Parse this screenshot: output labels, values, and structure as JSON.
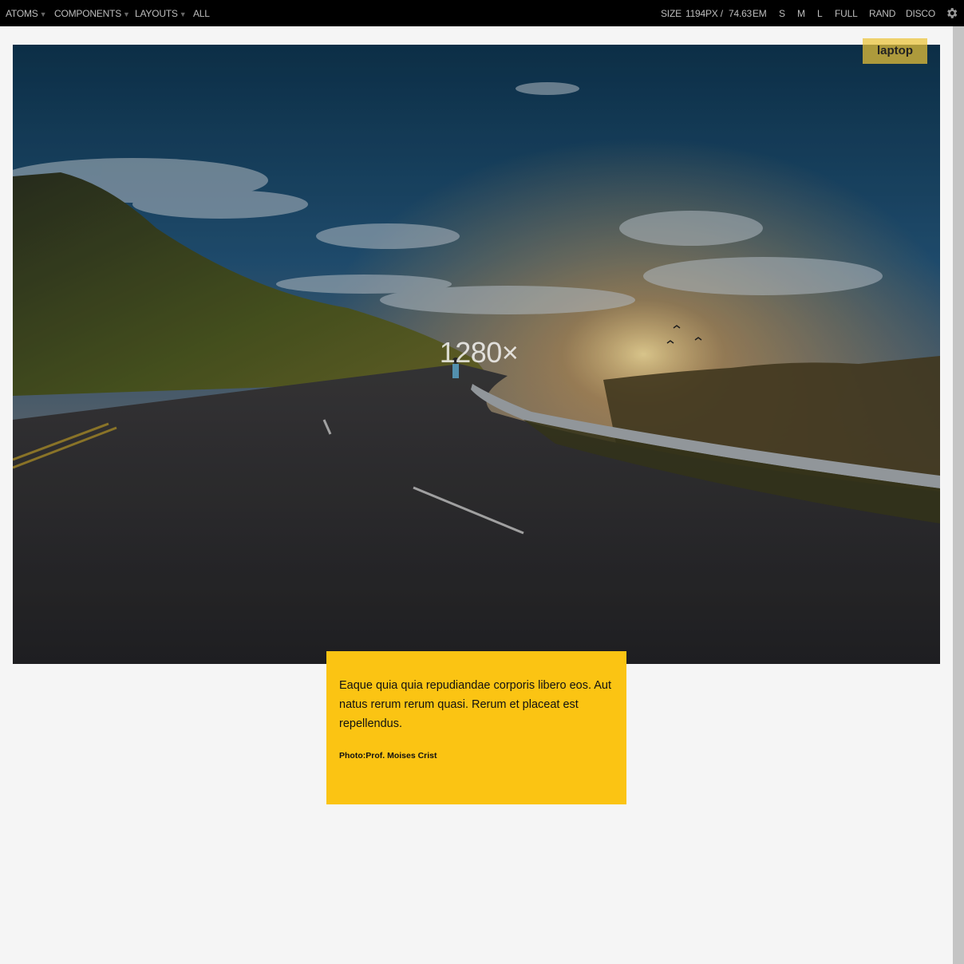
{
  "toolbar": {
    "atoms": "ATOMS",
    "components": "COMPONENTS",
    "layouts": "LAYOUTS",
    "all": "ALL",
    "size_label": "SIZE",
    "size_px": "1194",
    "px_unit": "PX /",
    "size_em": "74.63",
    "em_unit": "EM",
    "s": "S",
    "m": "M",
    "l": "L",
    "full": "FULL",
    "rand": "RAND",
    "disco": "DISCO",
    "caret_icon": "caret-down-icon",
    "settings_icon": "gear-icon"
  },
  "breakpoint_badge": "laptop",
  "hero": {
    "placeholder_label": "1280×"
  },
  "caption": {
    "text": "Eaque quia quia repudiandae corporis libero eos. Aut natus rerum rerum quasi. Rerum et placeat est repellendus.",
    "credit": "Photo:Prof. Moises Crist"
  },
  "colors": {
    "toolbar_bg": "#000000",
    "toolbar_text": "#bdbdbd",
    "caption_bg": "#fbc413",
    "badge_bg": "#ecc437",
    "page_bg": "#f5f5f5"
  }
}
